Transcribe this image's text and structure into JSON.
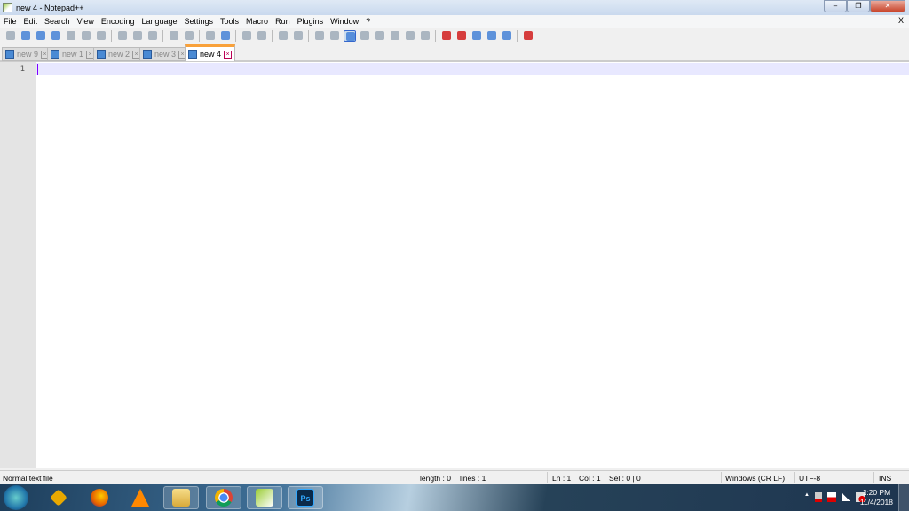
{
  "window": {
    "title": "new 4 - Notepad++",
    "minimize": "–",
    "maximize": "❐",
    "close": "✕"
  },
  "menu": [
    "File",
    "Edit",
    "Search",
    "View",
    "Encoding",
    "Language",
    "Settings",
    "Tools",
    "Macro",
    "Run",
    "Plugins",
    "Window",
    "?"
  ],
  "menu_close": "X",
  "toolbar": [
    [
      "new-file-icon",
      "open-file-icon",
      "save-icon",
      "save-all-icon",
      "close-icon",
      "close-all-icon",
      "print-icon"
    ],
    [
      "cut-icon",
      "copy-icon",
      "paste-icon"
    ],
    [
      "undo-icon",
      "redo-icon"
    ],
    [
      "find-icon",
      "replace-icon"
    ],
    [
      "zoom-in-icon",
      "zoom-out-icon"
    ],
    [
      "sync-vertical-icon",
      "sync-horizontal-icon"
    ],
    [
      "word-wrap-icon",
      "show-all-characters-icon",
      "indent-guide-icon",
      "udl-icon",
      "document-map-icon",
      "function-list-icon",
      "folder-workspace-icon",
      "monitoring-icon"
    ],
    [
      "record-macro-icon",
      "stop-record-icon",
      "play-macro-icon",
      "run-macro-multiple-icon",
      "save-macro-icon"
    ],
    [
      "spell-check-icon"
    ]
  ],
  "toolbar_colors": {
    "default": "#9aa7b5",
    "accent": "#3a7bd5",
    "record": "#d01010"
  },
  "tabs": [
    {
      "label": "new 9"
    },
    {
      "label": "new 1"
    },
    {
      "label": "new 2"
    },
    {
      "label": "new 3"
    },
    {
      "label": "new 4",
      "active": true
    }
  ],
  "editor": {
    "line_numbers": [
      "1"
    ],
    "content": ""
  },
  "status": {
    "file_type": "Normal text file",
    "length": "length : 0",
    "lines": "lines : 1",
    "ln": "Ln : 1",
    "col": "Col : 1",
    "sel": "Sel : 0 | 0",
    "eol": "Windows (CR LF)",
    "encoding": "UTF-8",
    "mode": "INS"
  },
  "taskbar": {
    "apps": [
      "winamp",
      "firefox",
      "vlc",
      "file-explorer",
      "chrome",
      "notepad-plus-plus",
      "photoshop"
    ],
    "photoshop_label": "Ps",
    "tray_arrow": "▲",
    "time": "1:20 PM",
    "date": "11/4/2018"
  }
}
